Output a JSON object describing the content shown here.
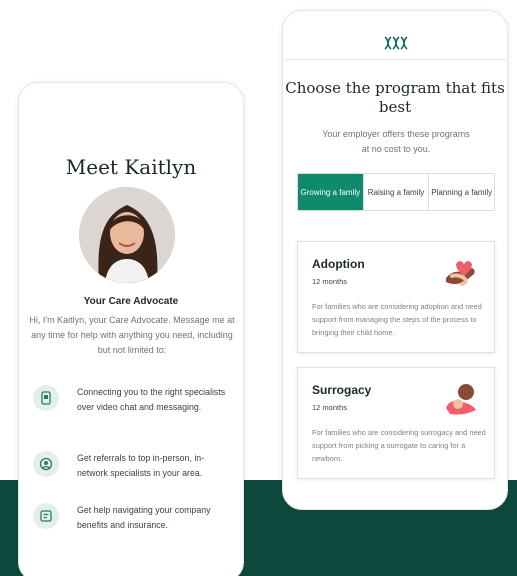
{
  "left_card": {
    "title": "Meet Kaitlyn",
    "role": "Your Care Advocate",
    "intro": "Hi, I'm Kaitlyn, your Care Advocate. Message me at any time for help with anything you need, including but not limited to:",
    "features": [
      {
        "icon": "phone-icon",
        "text": "Connecting you to the right specialists over video chat and messaging."
      },
      {
        "icon": "user-search-icon",
        "text": "Get referrals to top in-person, in-network specialists in your area."
      },
      {
        "icon": "document-icon",
        "text": "Get help navigating your company benefits and insurance."
      }
    ]
  },
  "right_card": {
    "logo_icon": "brand-logo-icon",
    "title": "Choose the program that fits best",
    "subtitle": "Your employer offers these programs at no cost to you.",
    "tabs": [
      {
        "label": "Growing a family",
        "active": true
      },
      {
        "label": "Raising a family",
        "active": false
      },
      {
        "label": "Planning a family",
        "active": false
      }
    ],
    "programs": [
      {
        "name": "Adoption",
        "duration": "12 months",
        "icon": "hands-heart-icon",
        "description": "For families who are considering adoption and need support from managing the steps of the process to bringing their child home."
      },
      {
        "name": "Surrogacy",
        "duration": "12 months",
        "icon": "baby-hold-icon",
        "description": "For families who are considering surrogacy and need support from picking a surrogate to caring for a newborn."
      }
    ]
  },
  "colors": {
    "accent": "#0f8a6c",
    "band": "#0f4a3f",
    "icon_bg": "#e3efe9"
  }
}
